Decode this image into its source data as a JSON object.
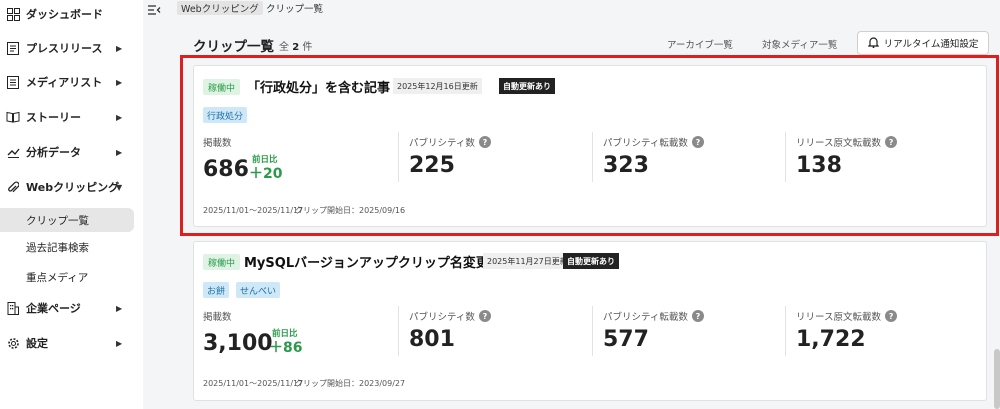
{
  "sidebar": {
    "items": [
      {
        "label": "ダッシュボード",
        "icon": "dashboard-icon",
        "caret": ""
      },
      {
        "label": "プレスリリース",
        "icon": "document-icon",
        "caret": "▶"
      },
      {
        "label": "メディアリスト",
        "icon": "list-icon",
        "caret": "▶"
      },
      {
        "label": "ストーリー",
        "icon": "book-icon",
        "caret": "▶"
      },
      {
        "label": "分析データ",
        "icon": "chart-icon",
        "caret": "▶"
      },
      {
        "label": "Webクリッピング",
        "icon": "paperclip-icon",
        "caret": "▼"
      },
      {
        "label": "企業ページ",
        "icon": "building-icon",
        "caret": "▶"
      },
      {
        "label": "設定",
        "icon": "gear-icon",
        "caret": "▶"
      }
    ],
    "sub_items": [
      {
        "label": "クリップ一覧"
      },
      {
        "label": "過去記事検索"
      },
      {
        "label": "重点メディア"
      }
    ]
  },
  "breadcrumb": {
    "parent": "Webクリッピング",
    "current": "クリップ一覧"
  },
  "header": {
    "title": "クリップ一覧",
    "count_prefix": "全",
    "count_value": "2",
    "count_suffix": "件",
    "archive_link": "アーカイブ一覧",
    "media_link": "対象メディア一覧",
    "realtime_button": "リアルタイム通知設定"
  },
  "clips": [
    {
      "status": "稼働中",
      "title": "「行政処分」を含む記事",
      "updated": "2025年12月16日更新",
      "auto": "自動更新あり",
      "tags": [
        "行政処分"
      ],
      "stats": {
        "listed_label": "掲載数",
        "listed_value": "686",
        "delta_label": "前日比",
        "delta_value": "＋20",
        "publicity_label": "パブリシティ数",
        "publicity_value": "225",
        "publicity_reprint_label": "パブリシティ転載数",
        "publicity_reprint_value": "323",
        "release_reprint_label": "リリース原文転載数",
        "release_reprint_value": "138"
      },
      "period": "2025/11/01～2025/11/17",
      "start": "クリップ開始日：2025/09/16"
    },
    {
      "status": "稼働中",
      "title": "MySQLバージョンアップクリップ名変更",
      "updated": "2025年11月27日更新",
      "auto": "自動更新あり",
      "tags": [
        "お餅",
        "せんべい"
      ],
      "stats": {
        "listed_label": "掲載数",
        "listed_value": "3,100",
        "delta_label": "前日比",
        "delta_value": "＋86",
        "publicity_label": "パブリシティ数",
        "publicity_value": "801",
        "publicity_reprint_label": "パブリシティ転載数",
        "publicity_reprint_value": "577",
        "release_reprint_label": "リリース原文転載数",
        "release_reprint_value": "1,722"
      },
      "period": "2025/11/01～2025/11/17",
      "start": "クリップ開始日：2023/09/27"
    }
  ],
  "help_glyph": "?",
  "colors": {
    "accent_green": "#2a9a49",
    "tag_blue": "#cfe8f8",
    "highlight_red": "#dd1f1f"
  }
}
